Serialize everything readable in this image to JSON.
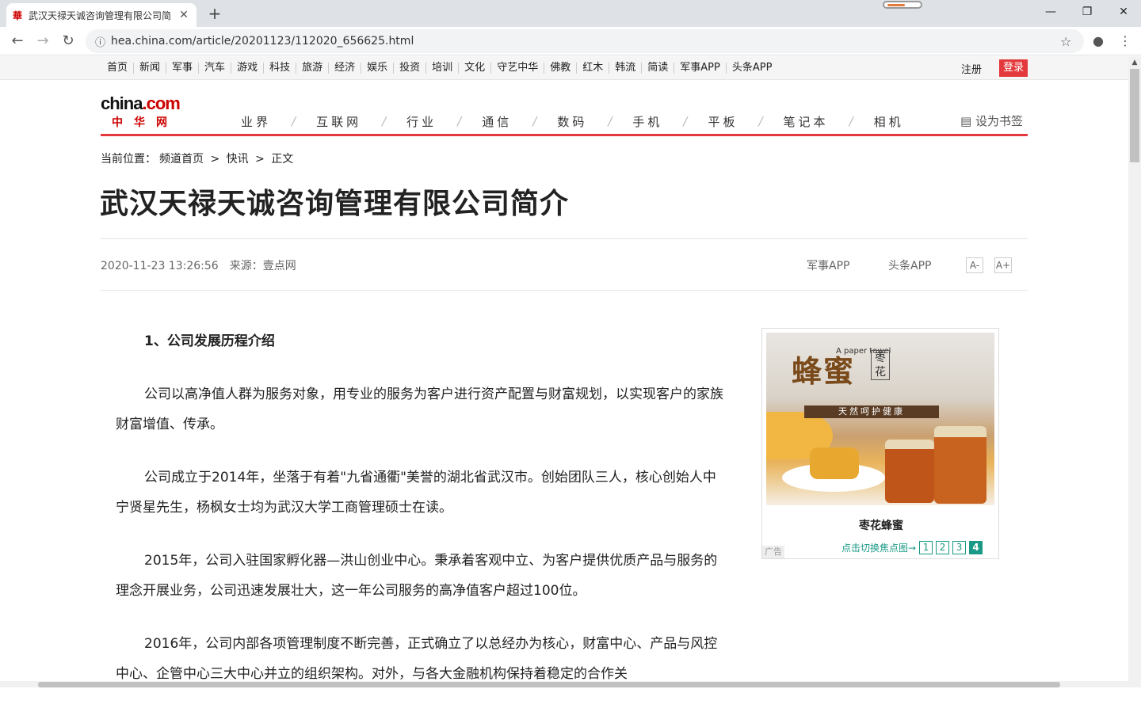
{
  "browser": {
    "tab_title": "武汉天禄天诚咨询管理有限公司简",
    "favicon": "華",
    "url": "hea.china.com/article/20201123/112020_656625.html"
  },
  "topnav": {
    "links": [
      "首页",
      "新闻",
      "军事",
      "汽车",
      "游戏",
      "科技",
      "旅游",
      "经济",
      "娱乐",
      "投资",
      "培训",
      "文化",
      "守艺中华",
      "佛教",
      "红木",
      "韩流",
      "简读",
      "军事APP",
      "头条APP"
    ],
    "register": "注册",
    "login": "登录"
  },
  "header": {
    "logo_en_main": "china",
    "logo_en_com": ".com",
    "logo_cn": "中华网",
    "channels": [
      "业界",
      "互联网",
      "行业",
      "通信",
      "数码",
      "手机",
      "平板",
      "笔记本",
      "相机"
    ],
    "bookmark": "设为书签"
  },
  "breadcrumb": {
    "prefix": "当前位置：",
    "home": "频道首页",
    "sep": ">",
    "section": "快讯",
    "current": "正文"
  },
  "article": {
    "title": "武汉天禄天诚咨询管理有限公司简介",
    "datetime": "2020-11-23 13:26:56",
    "source": "来源：壹点网",
    "app1": "军事APP",
    "app2": "头条APP",
    "font_smaller": "A-",
    "font_larger": "A+",
    "section1": "1、公司发展历程介绍",
    "paragraphs": [
      "公司以高净值人群为服务对象，用专业的服务为客户进行资产配置与财富规划，以实现客户的家族财富增值、传承。",
      "公司成立于2014年，坐落于有着\"九省通衢\"美誉的湖北省武汉市。创始团队三人，核心创始人中宁贤星先生，杨枫女士均为武汉大学工商管理硕士在读。",
      "2015年，公司入驻国家孵化器—洪山创业中心。秉承着客观中立、为客户提供优质产品与服务的理念开展业务，公司迅速发展壮大，这一年公司服务的高净值客户超过100位。",
      "2016年，公司内部各项管理制度不断完善，正式确立了以总经办为核心，财富中心、产品与风控中心、企管中心三大中心并立的组织架构。对外，与各大金融机构保持着稳定的合作关"
    ]
  },
  "ad": {
    "big_text": "蜂蜜",
    "small_text": "A paper towel",
    "side_text": "枣花",
    "band": "天然呵护健康",
    "caption": "枣花蜂蜜",
    "tag": "广告",
    "switch_label": "点击切换焦点图→",
    "pages": [
      "1",
      "2",
      "3",
      "4"
    ],
    "active_page": "4"
  },
  "colors": {
    "accent": "#e4393c",
    "link_teal": "#1a9a86"
  }
}
